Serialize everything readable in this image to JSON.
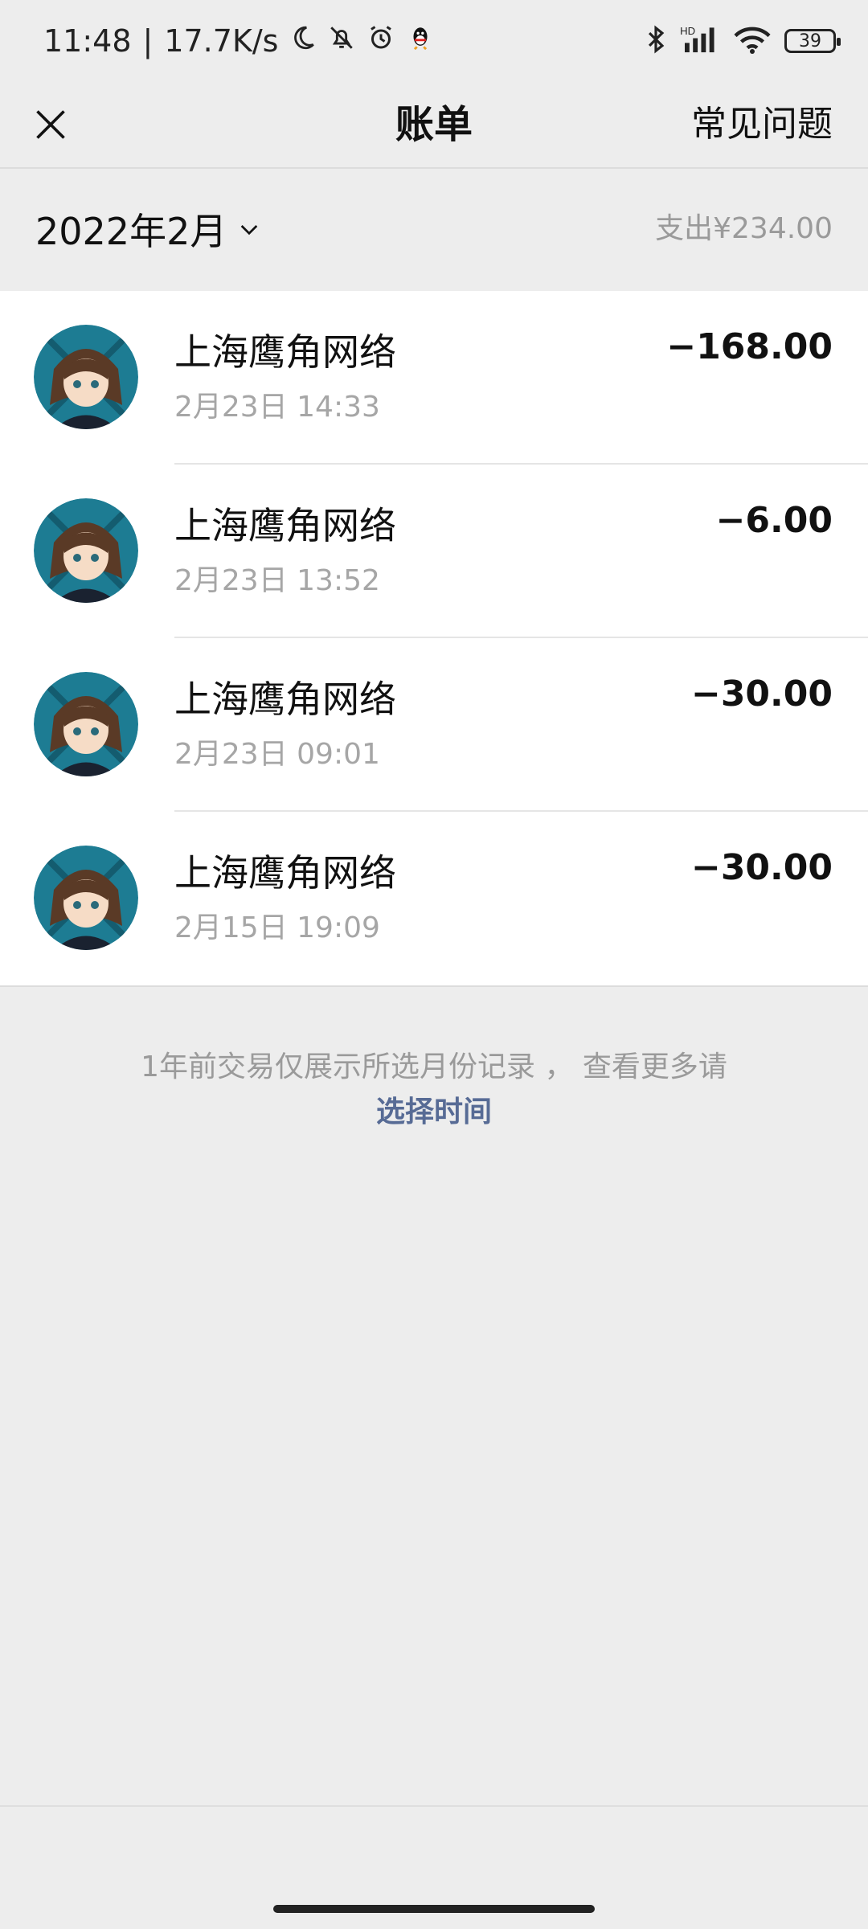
{
  "status_bar": {
    "time": "11:48",
    "network_speed": "17.7K/s",
    "battery": "39",
    "hd_label": "HD",
    "icons_left": [
      "moon-icon",
      "bell-off-icon",
      "alarm-icon",
      "qq-icon"
    ],
    "icons_right": [
      "bluetooth-icon",
      "signal-icon",
      "wifi-icon",
      "battery-icon"
    ]
  },
  "header": {
    "title": "账单",
    "faq": "常见问题",
    "close_icon": "close-icon"
  },
  "month_bar": {
    "month": "2022年2月",
    "expense": "支出¥234.00"
  },
  "transactions": [
    {
      "merchant": "上海鹰角网络",
      "datetime": "2月23日 14:33",
      "amount": "−168.00"
    },
    {
      "merchant": "上海鹰角网络",
      "datetime": "2月23日 13:52",
      "amount": "−6.00"
    },
    {
      "merchant": "上海鹰角网络",
      "datetime": "2月23日 09:01",
      "amount": "−30.00"
    },
    {
      "merchant": "上海鹰角网络",
      "datetime": "2月15日 19:09",
      "amount": "−30.00"
    }
  ],
  "note": {
    "text": "1年前交易仅展示所选月份记录 ， 查看更多请",
    "link": "选择时间"
  },
  "colors": {
    "background": "#ededed",
    "link": "#576b95",
    "secondary_text": "#9a9a9a"
  }
}
